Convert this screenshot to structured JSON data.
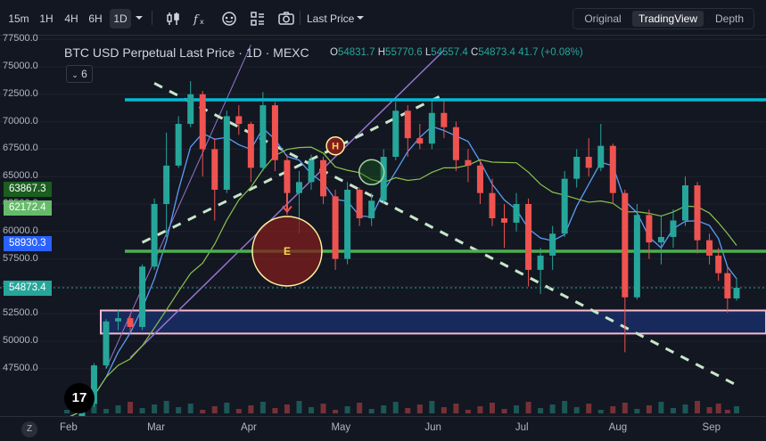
{
  "toolbar": {
    "intervals": [
      "15m",
      "1H",
      "4H",
      "6H",
      "1D"
    ],
    "active_interval": "1D",
    "price_type": "Last Price",
    "views": [
      "Original",
      "TradingView",
      "Depth"
    ],
    "active_view": "TradingView",
    "icons": [
      "candles-icon",
      "indicators-icon",
      "templates-icon",
      "layout-icon",
      "camera-icon"
    ]
  },
  "legend": {
    "title": "BTC USD Perpetual Last Price · 1D · MEXC",
    "ohlc": [
      {
        "k": "O",
        "v": "54831.7"
      },
      {
        "k": "H",
        "v": "55770.6"
      },
      {
        "k": "L",
        "v": "54557.4"
      },
      {
        "k": "C",
        "v": "54873.4"
      }
    ],
    "change": "41.7 (+0.08%)",
    "indicators_count": "6"
  },
  "colors": {
    "background": "#131722",
    "up": "#26a69a",
    "down": "#ef5350",
    "resistance": "#00bcd4",
    "support": "#4caf50",
    "zone": "#1e3a8a",
    "zone_border": "#f8bbd0",
    "ma_fast": "#5b9cf6",
    "ma_slow": "#8bc34a",
    "trend_dashed": "#c8e6c9",
    "channel": "#9575cd"
  },
  "chart_data": {
    "type": "candlestick",
    "symbol": "BTC USD Perpetual",
    "interval": "1D",
    "exchange": "MEXC",
    "y_ticks": [
      47500,
      50000,
      52500,
      55000,
      57500,
      60000,
      62500,
      65000,
      67500,
      70000,
      72500,
      75000,
      77500
    ],
    "y_tick_labels": [
      "47500.0",
      "50000.0",
      "52500.0",
      "55000.0",
      "57500.0",
      "60000.0",
      "62500.0",
      "65000.0",
      "67500.0",
      "70000.0",
      "72500.0",
      "75000.0",
      "77500.0"
    ],
    "x_labels": [
      "Feb",
      "Mar",
      "Apr",
      "May",
      "Jun",
      "Jul",
      "Aug",
      "Sep"
    ],
    "price_tags": [
      {
        "value": 63867.3,
        "label": "63867.3",
        "color": "#1b5e20"
      },
      {
        "value": 62172.4,
        "label": "62172.4",
        "color": "#66bb6a"
      },
      {
        "value": 58930.3,
        "label": "58930.3",
        "color": "#2962ff"
      },
      {
        "value": 54873.4,
        "label": "54873.4",
        "color": "#26a69a"
      }
    ],
    "last_price": 54873.4,
    "horizontal_levels": [
      {
        "name": "resistance",
        "value": 72000
      },
      {
        "name": "support",
        "value": 58200
      }
    ],
    "zone": {
      "from": 50700,
      "to": 52800
    },
    "markers": [
      "H",
      "E"
    ],
    "candles": [
      {
        "date": "2024-02-01",
        "o": 42500,
        "h": 43200,
        "l": 42000,
        "c": 43000
      },
      {
        "date": "2024-02-06",
        "o": 43000,
        "h": 44500,
        "l": 42800,
        "c": 44300
      },
      {
        "date": "2024-02-10",
        "o": 44300,
        "h": 48000,
        "l": 44000,
        "c": 47800
      },
      {
        "date": "2024-02-14",
        "o": 47800,
        "h": 52000,
        "l": 47500,
        "c": 51800
      },
      {
        "date": "2024-02-18",
        "o": 51800,
        "h": 52900,
        "l": 51000,
        "c": 52100
      },
      {
        "date": "2024-02-22",
        "o": 52100,
        "h": 52500,
        "l": 50800,
        "c": 51300
      },
      {
        "date": "2024-02-26",
        "o": 51300,
        "h": 57000,
        "l": 51000,
        "c": 56800
      },
      {
        "date": "2024-03-01",
        "o": 56800,
        "h": 63000,
        "l": 56500,
        "c": 62500
      },
      {
        "date": "2024-03-05",
        "o": 62500,
        "h": 69000,
        "l": 59500,
        "c": 66000
      },
      {
        "date": "2024-03-09",
        "o": 66000,
        "h": 70500,
        "l": 65800,
        "c": 69800
      },
      {
        "date": "2024-03-13",
        "o": 69800,
        "h": 73700,
        "l": 69500,
        "c": 72500
      },
      {
        "date": "2024-03-17",
        "o": 72500,
        "h": 72800,
        "l": 65000,
        "c": 67500
      },
      {
        "date": "2024-03-21",
        "o": 67500,
        "h": 68500,
        "l": 61000,
        "c": 63800
      },
      {
        "date": "2024-03-25",
        "o": 63800,
        "h": 71000,
        "l": 63500,
        "c": 70500
      },
      {
        "date": "2024-03-29",
        "o": 70500,
        "h": 71500,
        "l": 68800,
        "c": 69800
      },
      {
        "date": "2024-04-02",
        "o": 69800,
        "h": 70000,
        "l": 64500,
        "c": 65800
      },
      {
        "date": "2024-04-06",
        "o": 65800,
        "h": 72700,
        "l": 65500,
        "c": 71500
      },
      {
        "date": "2024-04-10",
        "o": 71500,
        "h": 71800,
        "l": 65500,
        "c": 66500
      },
      {
        "date": "2024-04-14",
        "o": 66500,
        "h": 67000,
        "l": 61500,
        "c": 63500
      },
      {
        "date": "2024-04-18",
        "o": 63500,
        "h": 65500,
        "l": 59800,
        "c": 64500
      },
      {
        "date": "2024-04-22",
        "o": 64500,
        "h": 67000,
        "l": 63800,
        "c": 66500
      },
      {
        "date": "2024-04-26",
        "o": 66500,
        "h": 66800,
        "l": 62500,
        "c": 63200
      },
      {
        "date": "2024-04-30",
        "o": 63200,
        "h": 63800,
        "l": 56500,
        "c": 57500
      },
      {
        "date": "2024-05-04",
        "o": 57500,
        "h": 64500,
        "l": 57000,
        "c": 63800
      },
      {
        "date": "2024-05-08",
        "o": 63800,
        "h": 64000,
        "l": 60500,
        "c": 61200
      },
      {
        "date": "2024-05-12",
        "o": 61200,
        "h": 63500,
        "l": 60500,
        "c": 62800
      },
      {
        "date": "2024-05-16",
        "o": 62800,
        "h": 67500,
        "l": 62500,
        "c": 66800
      },
      {
        "date": "2024-05-20",
        "o": 66800,
        "h": 71800,
        "l": 66500,
        "c": 71000
      },
      {
        "date": "2024-05-24",
        "o": 71000,
        "h": 71500,
        "l": 66800,
        "c": 68500
      },
      {
        "date": "2024-05-28",
        "o": 68500,
        "h": 69800,
        "l": 67500,
        "c": 68000
      },
      {
        "date": "2024-06-01",
        "o": 68000,
        "h": 71800,
        "l": 67500,
        "c": 70800
      },
      {
        "date": "2024-06-05",
        "o": 70800,
        "h": 71900,
        "l": 68500,
        "c": 69500
      },
      {
        "date": "2024-06-09",
        "o": 69500,
        "h": 70000,
        "l": 65500,
        "c": 66500
      },
      {
        "date": "2024-06-13",
        "o": 66500,
        "h": 67500,
        "l": 64500,
        "c": 66000
      },
      {
        "date": "2024-06-17",
        "o": 66000,
        "h": 66500,
        "l": 62500,
        "c": 63500
      },
      {
        "date": "2024-06-21",
        "o": 63500,
        "h": 64800,
        "l": 60500,
        "c": 61200
      },
      {
        "date": "2024-06-25",
        "o": 61200,
        "h": 62500,
        "l": 58500,
        "c": 60800
      },
      {
        "date": "2024-06-29",
        "o": 60800,
        "h": 63500,
        "l": 60000,
        "c": 62500
      },
      {
        "date": "2024-07-03",
        "o": 62500,
        "h": 63000,
        "l": 55000,
        "c": 56500
      },
      {
        "date": "2024-07-07",
        "o": 56500,
        "h": 58500,
        "l": 54300,
        "c": 57800
      },
      {
        "date": "2024-07-11",
        "o": 57800,
        "h": 60500,
        "l": 56500,
        "c": 59800
      },
      {
        "date": "2024-07-15",
        "o": 59800,
        "h": 65500,
        "l": 59500,
        "c": 64800
      },
      {
        "date": "2024-07-19",
        "o": 64800,
        "h": 67500,
        "l": 64000,
        "c": 66800
      },
      {
        "date": "2024-07-23",
        "o": 66800,
        "h": 68500,
        "l": 65000,
        "c": 65800
      },
      {
        "date": "2024-07-27",
        "o": 65800,
        "h": 69800,
        "l": 65500,
        "c": 67800
      },
      {
        "date": "2024-07-31",
        "o": 67800,
        "h": 68000,
        "l": 62500,
        "c": 63500
      },
      {
        "date": "2024-08-04",
        "o": 63500,
        "h": 63800,
        "l": 49000,
        "c": 54000
      },
      {
        "date": "2024-08-08",
        "o": 54000,
        "h": 62500,
        "l": 53800,
        "c": 61500
      },
      {
        "date": "2024-08-12",
        "o": 61500,
        "h": 62000,
        "l": 57500,
        "c": 59000
      },
      {
        "date": "2024-08-16",
        "o": 59000,
        "h": 61500,
        "l": 57000,
        "c": 59500
      },
      {
        "date": "2024-08-20",
        "o": 59500,
        "h": 62000,
        "l": 58500,
        "c": 61000
      },
      {
        "date": "2024-08-24",
        "o": 61000,
        "h": 65000,
        "l": 60500,
        "c": 64200
      },
      {
        "date": "2024-08-28",
        "o": 64200,
        "h": 64500,
        "l": 58000,
        "c": 59200
      },
      {
        "date": "2024-09-01",
        "o": 59200,
        "h": 59800,
        "l": 57000,
        "c": 57800
      },
      {
        "date": "2024-09-04",
        "o": 57800,
        "h": 58500,
        "l": 55500,
        "c": 56200
      },
      {
        "date": "2024-09-07",
        "o": 56200,
        "h": 56800,
        "l": 52600,
        "c": 53900
      },
      {
        "date": "2024-09-10",
        "o": 53900,
        "h": 55770,
        "l": 53700,
        "c": 54873
      }
    ]
  }
}
